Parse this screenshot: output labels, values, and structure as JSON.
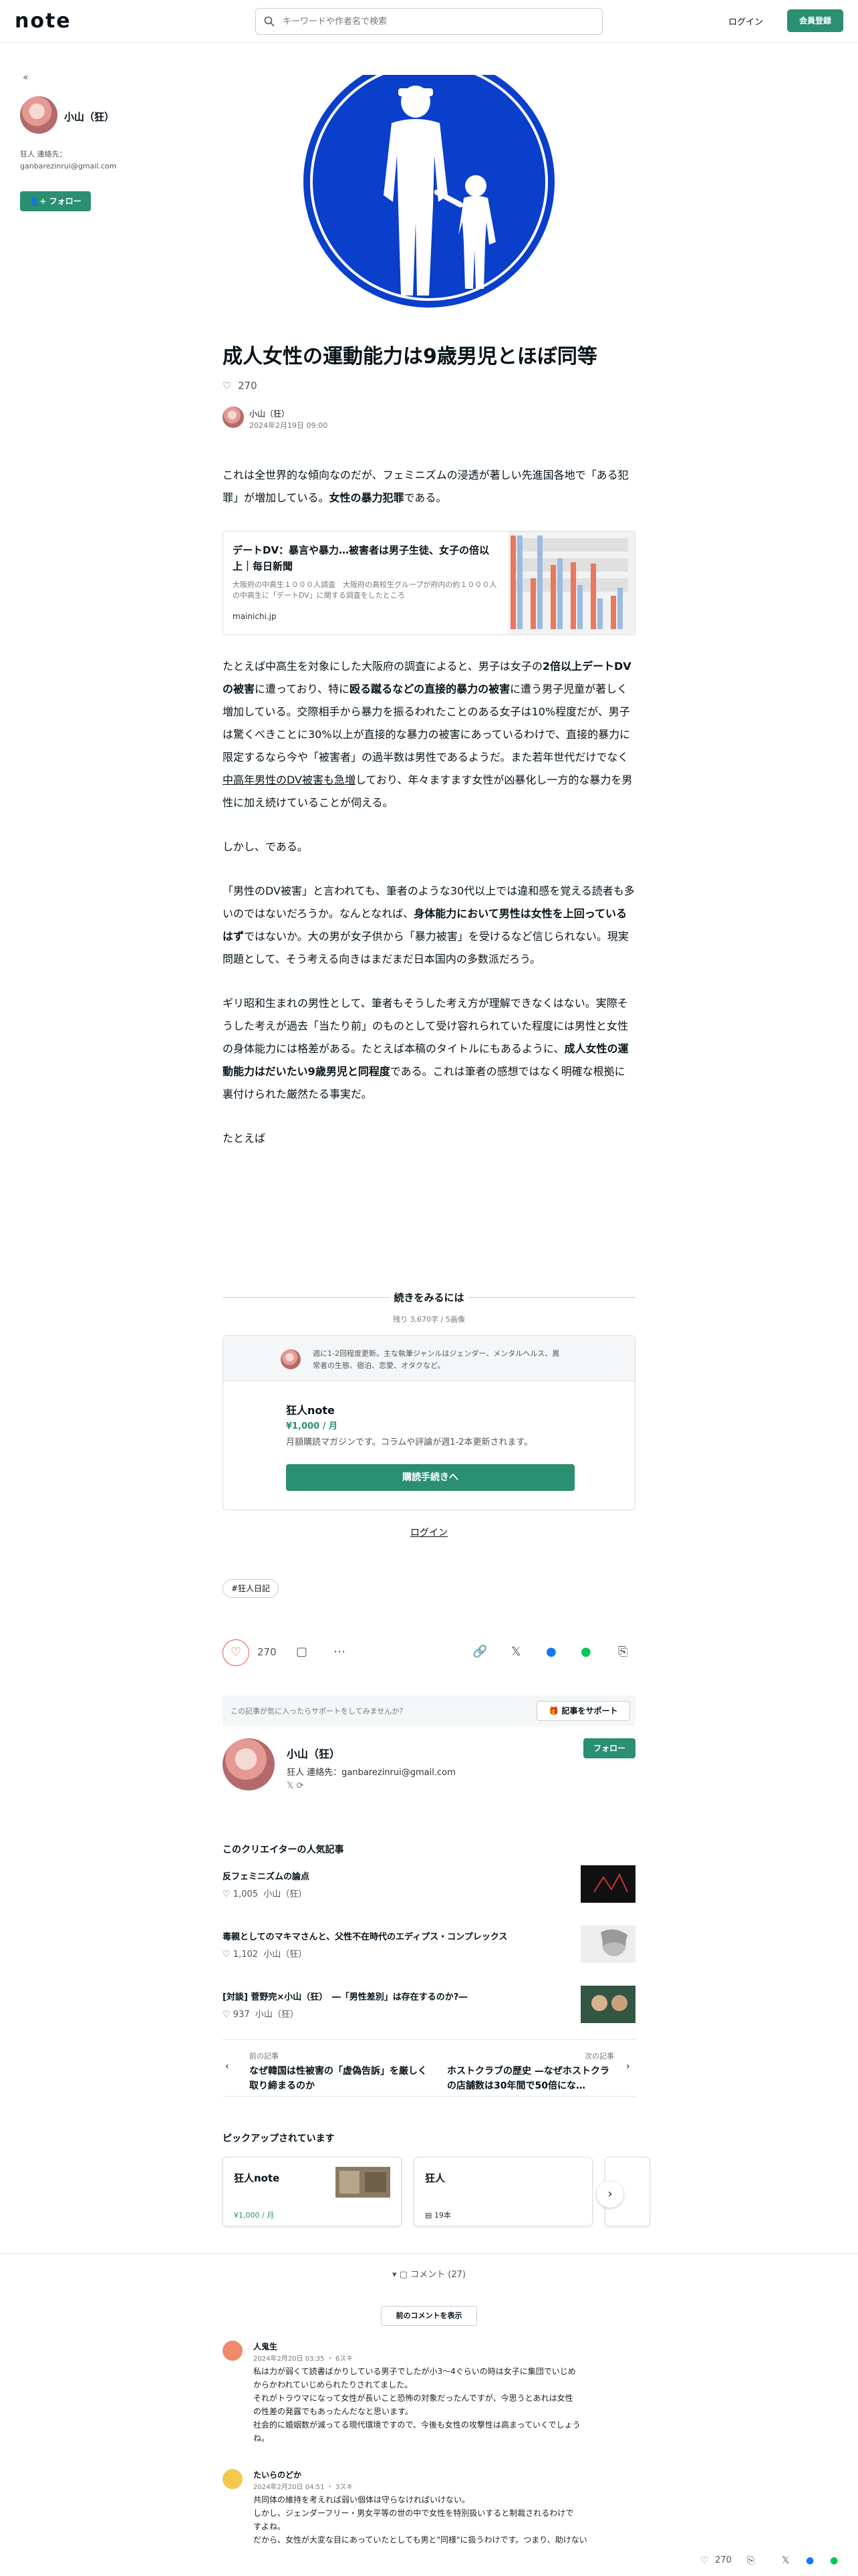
{
  "header": {
    "logo": "note",
    "search_placeholder": "キーワードや作者名で検索",
    "login": "ログイン",
    "signup": "会員登録"
  },
  "sidebar": {
    "collapse": "«",
    "author": "小山（狂）",
    "bio_line1": "狂人 連絡先：",
    "bio_line2": "ganbarezinrui@gmail.com",
    "follow": "フォロー"
  },
  "article": {
    "title": "成人女性の運動能力は9歳男児とほぼ同等",
    "likes": "270",
    "author": "小山（狂）",
    "date": "2024年2月19日 09:00",
    "p1a": "これは全世界的な傾向なのだが、フェミニズムの浸透が著しい先進国各地で「ある犯罪」が増加している。",
    "p1b": "女性の暴力犯罪",
    "p1c": "である。",
    "embed_title": "デートDV：暴言や暴力…被害者は男子生徒、女子の倍以上｜毎日新聞",
    "embed_desc": "大阪府の中高生１０００人調査　大阪府の高校生グループが府内の約１０００人の中高生に「デートDV」に関する調査をしたところ",
    "embed_source": "mainichi.jp",
    "p2a": "たとえば中高生を対象にした大阪府の調査によると、男子は女子の",
    "p2b": "2倍以上デートDVの被害",
    "p2c": "に遭っており、特に",
    "p2d": "殴る蹴るなどの直接的暴力の被害",
    "p2e": "に遭う男子児童が著しく増加している。交際相手から暴力を振るわれたことのある女子は10%程度だが、男子は驚くべきことに30%以上が直接的な暴力の被害にあっているわけで、直接的暴力に限定するなら今や「被害者」の過半数は男性であるようだ。また若年世代だけでなく",
    "p2f": "中高年男性のDV被害も急増",
    "p2g": "しており、年々ますます女性が凶暴化し一方的な暴力を男性に加え続けていることが伺える。",
    "p3": "しかし、である。",
    "p4a": "「男性のDV被害」と言われても、筆者のような30代以上では違和感を覚える読者も多いのではないだろうか。なんとなれば、",
    "p4b": "身体能力において男性は女性を上回っているはず",
    "p4c": "ではないか。大の男が女子供から「暴力被害」を受けるなど信じられない。現実問題として、そう考える向きはまだまだ日本国内の多数派だろう。",
    "p5a": "ギリ昭和生まれの男性として、筆者もそうした考え方が理解できなくはない。実際そうした考えが過去「当たり前」のものとして受け容れられていた程度には男性と女性の身体能力には格差がある。たとえば本稿のタイトルにもあるように、",
    "p5b": "成人女性の運動能力はだいたい9歳男児と同程度",
    "p5c": "である。これは筆者の感想ではなく明確な根拠に裏付けられた厳然たる事実だ。",
    "p6": "たとえば"
  },
  "paywall": {
    "heading": "続きをみるには",
    "remaining": "残り 3,670字 / 5画像",
    "desc": "週に1-2回程度更新。主な執筆ジャンルはジェンダー、メンタルヘルス、異常者の生態、宿泊、恋愛、オタクなど。",
    "magazine": "狂人note",
    "price": "¥1,000 / 月",
    "magazine_desc": "月額購読マガジンです。コラムや評論が週1-2本更新されます。",
    "buy": "購読手続きへ",
    "login": "ログイン"
  },
  "tag": "#狂人日記",
  "actions": {
    "likes": "270"
  },
  "support": {
    "question": "この記事が気に入ったらサポートをしてみませんか？",
    "button": "記事をサポート"
  },
  "profile": {
    "name": "小山（狂）",
    "bio": "狂人 連絡先：ganbarezinrui@gmail.com",
    "icons": "𝕏  ⟳",
    "follow": "フォロー"
  },
  "popular": {
    "heading": "このクリエイターの人気記事",
    "items": [
      {
        "title": "反フェミニズムの論点",
        "likes": "1,005",
        "author": "小山（狂）"
      },
      {
        "title": "毒親としてのマキマさんと、父性不在時代のエディプス・コンプレックス",
        "likes": "1,102",
        "author": "小山（狂）"
      },
      {
        "title": "[対談] 菅野完×小山（狂）　―「男性差別」は存在するのか?―",
        "likes": "937",
        "author": "小山（狂）"
      }
    ]
  },
  "navigation": {
    "prev_label": "前の記事",
    "prev_title": "なぜ韓国は性被害の「虚偽告訴」を厳しく取り締まるのか",
    "next_label": "次の記事",
    "next_title": "ホストクラブの歴史 —なぜホストクラの店舗数は30年間で50倍にな…"
  },
  "picked": {
    "heading": "ピックアップされています",
    "cards": [
      {
        "title": "狂人note",
        "meta": "¥1,000 / 月"
      },
      {
        "title": "狂人",
        "meta": "19本"
      }
    ]
  },
  "comments": {
    "toggle": "コメント (27)",
    "prev": "前のコメントを表示",
    "items": [
      {
        "name": "人鬼生",
        "date": "2024年2月20日 03:35  ・  6スキ",
        "body1": "私は力が弱くて読書ばかりしている男子でしたが小3〜4ぐらいの時は女子に集団でいじめ",
        "body2": "からかわれていじめられたりされてました。",
        "body3": "それがトラウマになって女性が長いこと恐怖の対象だったんですが、今思うとあれは女性",
        "body4": "の性差の発露でもあったんだなと思います。",
        "body5": "社会的に婚姻数が減ってる現代環境ですので、今後も女性の攻撃性は高まっていくでしょう",
        "body6": "ね。"
      },
      {
        "name": "たいらのどか",
        "date": "2024年2月20日 04:51  ・  3スキ",
        "body1": "共同体の維持を考えれば弱い個体は守らなければいけない。",
        "body2": "しかし、ジェンダーフリー・男女平等の世の中で女性を特別扱いすると制裁されるわけで",
        "body3": "すよね。",
        "body4": "だから、女性が大変な目にあっていたとしても男と\"同様\"に扱うわけです。つまり、助けない",
        "body5": "",
        "body6": ""
      }
    ]
  },
  "floatbar": {
    "likes": "270"
  },
  "colors": {
    "accent": "#2b8f72",
    "heart": "#e5534b",
    "sign_blue": "#0a3fcc"
  }
}
